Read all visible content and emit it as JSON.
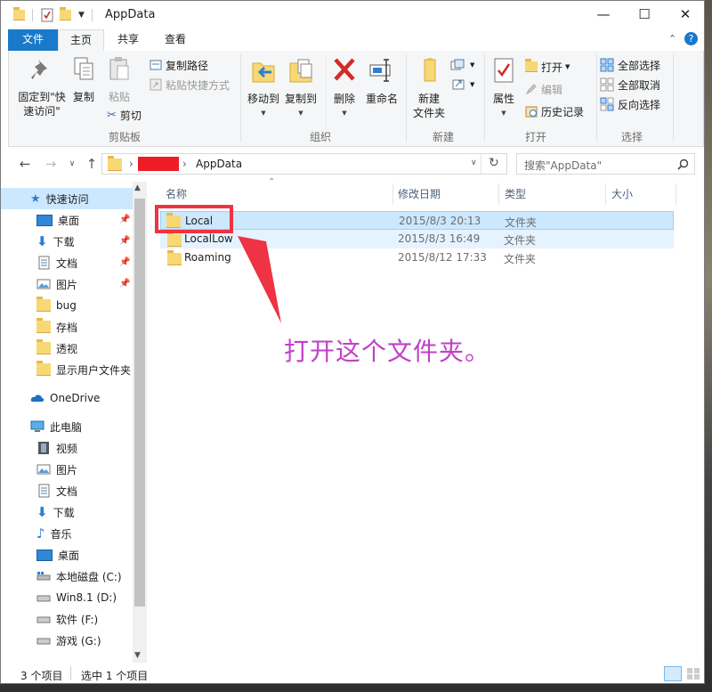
{
  "window": {
    "title": "AppData"
  },
  "ribbon_tabs": [
    {
      "label": "文件"
    },
    {
      "label": "主页"
    },
    {
      "label": "共享"
    },
    {
      "label": "查看"
    }
  ],
  "ribbon": {
    "clipboard": {
      "pin_quick_access": "固定到\"快\n速访问\"",
      "copy": "复制",
      "paste": "粘贴",
      "copy_path": "复制路径",
      "paste_shortcut": "粘贴快捷方式",
      "cut": "剪切",
      "group_label": "剪贴板"
    },
    "organize": {
      "move_to": "移动到",
      "copy_to": "复制到",
      "delete": "删除",
      "rename": "重命名",
      "group_label": "组织"
    },
    "new": {
      "new_folder": "新建\n文件夹",
      "group_label": "新建"
    },
    "open": {
      "properties": "属性",
      "open": "打开",
      "edit": "编辑",
      "history": "历史记录",
      "group_label": "打开"
    },
    "select": {
      "select_all": "全部选择",
      "select_none": "全部取消",
      "invert": "反向选择",
      "group_label": "选择"
    }
  },
  "address": {
    "current_folder": "AppData",
    "redacted_color": "#ee1c24"
  },
  "search": {
    "placeholder": "搜索\"AppData\""
  },
  "nav_pane": {
    "items": [
      {
        "label": "快速访问"
      },
      {
        "label": "桌面"
      },
      {
        "label": "下载"
      },
      {
        "label": "文档"
      },
      {
        "label": "图片"
      },
      {
        "label": "bug"
      },
      {
        "label": "存档"
      },
      {
        "label": "透视"
      },
      {
        "label": "显示用户文件夹"
      },
      {
        "label": "OneDrive"
      },
      {
        "label": "此电脑"
      },
      {
        "label": "视频"
      },
      {
        "label": "图片"
      },
      {
        "label": "文档"
      },
      {
        "label": "下载"
      },
      {
        "label": "音乐"
      },
      {
        "label": "桌面"
      },
      {
        "label": "本地磁盘 (C:)"
      },
      {
        "label": "Win8.1 (D:)"
      },
      {
        "label": "软件 (F:)"
      },
      {
        "label": "游戏 (G:)"
      }
    ]
  },
  "columns": {
    "name": "名称",
    "date": "修改日期",
    "type": "类型",
    "size": "大小"
  },
  "files": [
    {
      "name": "Local",
      "date": "2015/8/3 20:13",
      "type": "文件夹"
    },
    {
      "name": "LocalLow",
      "date": "2015/8/3 16:49",
      "type": "文件夹"
    },
    {
      "name": "Roaming",
      "date": "2015/8/12 17:33",
      "type": "文件夹"
    }
  ],
  "status": {
    "item_count": "3 个项目",
    "selected": "选中 1 个项目"
  },
  "annotation": {
    "text": "打开这个文件夹。",
    "color": "#c040c8",
    "highlight_color": "#ee3344"
  }
}
